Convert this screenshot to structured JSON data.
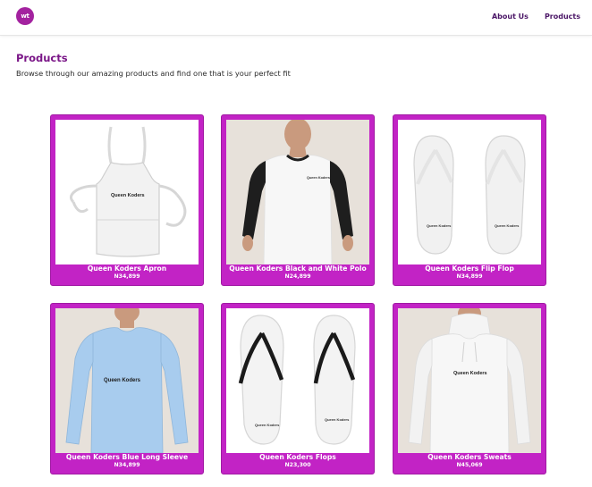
{
  "header": {
    "logo_text": "wt",
    "nav": [
      {
        "label": "About Us"
      },
      {
        "label": "Products"
      }
    ]
  },
  "page": {
    "title": "Products",
    "subtitle": "Browse through our amazing products and find one that is your perfect fit"
  },
  "products": [
    {
      "name": "Queen Koders Apron",
      "price": "N34,899",
      "image": "apron-image",
      "print": "Queen Koders"
    },
    {
      "name": "Queen Koders Black and White Polo",
      "price": "N24,899",
      "image": "polo-image",
      "print": "Queen Koders"
    },
    {
      "name": "Queen Koders Flip Flop",
      "price": "N34,899",
      "image": "flip-flop-image",
      "print": "Queen Koders"
    },
    {
      "name": "Queen Koders Blue Long Sleeve",
      "price": "N34,899",
      "image": "long-sleeve-image",
      "print": "Queen Koders"
    },
    {
      "name": "Queen Koders Flops",
      "price": "N23,300",
      "image": "flops-image",
      "print": "Queen Koders"
    },
    {
      "name": "Queen Koders Sweats",
      "price": "N45,069",
      "image": "sweats-image",
      "print": "Queen Koders"
    }
  ],
  "colors": {
    "brand": "#a3229f",
    "card": "#c223c5",
    "heading": "#7b1788",
    "nav": "#4a1566"
  }
}
